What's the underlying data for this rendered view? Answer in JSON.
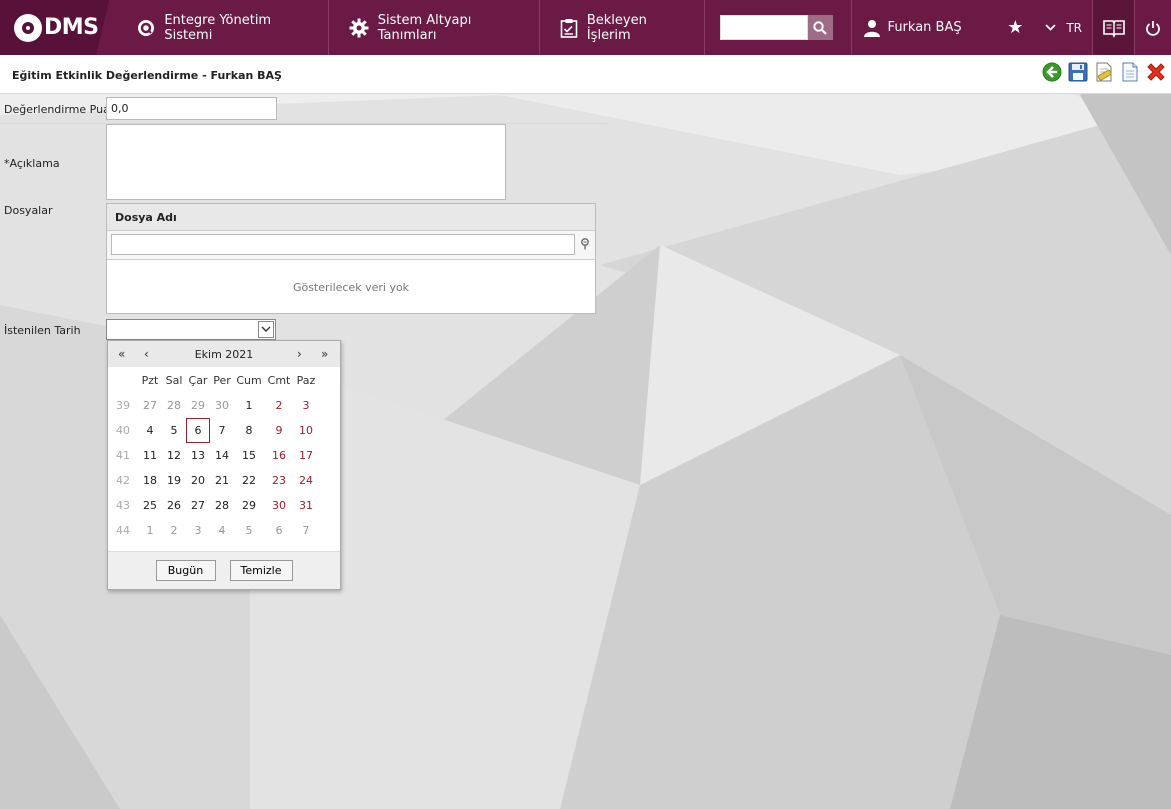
{
  "header": {
    "logo_text": "DMS",
    "nav": [
      {
        "label": "Entegre Yönetim Sistemi"
      },
      {
        "label": "Sistem Altyapı Tanımları"
      },
      {
        "label": "Bekleyen İşlerim"
      }
    ],
    "search": {
      "value": "",
      "placeholder": ""
    },
    "user": "Furkan BAŞ",
    "language": "TR"
  },
  "page": {
    "title": "Eğitim Etkinlik Değerlendirme - Furkan BAŞ"
  },
  "form": {
    "score_label": "Değerlendirme Puanı",
    "score_value": "0,0",
    "description_label": "*Açıklama",
    "description_value": "",
    "files_label": "Dosyalar",
    "files_column": "Dosya Adı",
    "files_empty": "Gösterilecek veri yok",
    "date_label": "İstenilen Tarih",
    "date_value": ""
  },
  "calendar": {
    "month_label": "Ekim 2021",
    "day_headers": [
      "Pzt",
      "Sal",
      "Çar",
      "Per",
      "Cum",
      "Cmt",
      "Paz"
    ],
    "weeks": [
      {
        "week": "39",
        "days": [
          "27",
          "28",
          "29",
          "30",
          "1",
          "2",
          "3"
        ]
      },
      {
        "week": "40",
        "days": [
          "4",
          "5",
          "6",
          "7",
          "8",
          "9",
          "10"
        ]
      },
      {
        "week": "41",
        "days": [
          "11",
          "12",
          "13",
          "14",
          "15",
          "16",
          "17"
        ]
      },
      {
        "week": "42",
        "days": [
          "18",
          "19",
          "20",
          "21",
          "22",
          "23",
          "24"
        ]
      },
      {
        "week": "43",
        "days": [
          "25",
          "26",
          "27",
          "28",
          "29",
          "30",
          "31"
        ]
      },
      {
        "week": "44",
        "days": [
          "1",
          "2",
          "3",
          "4",
          "5",
          "6",
          "7"
        ]
      }
    ],
    "today_label": "Bugün",
    "clear_label": "Temizle"
  },
  "colors": {
    "topbar": "#6b1a45",
    "weekend": "#a01e2a"
  }
}
